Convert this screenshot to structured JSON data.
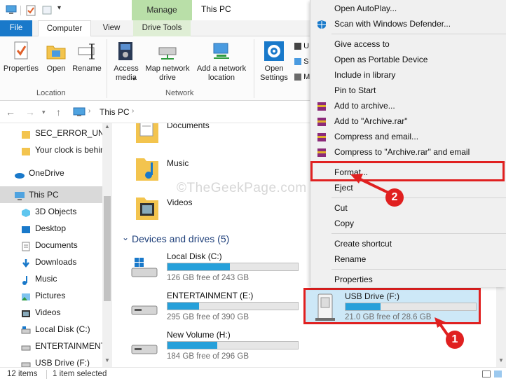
{
  "window": {
    "title": "This PC",
    "manage_tab": "Manage"
  },
  "ribbon_tabs": {
    "file": "File",
    "computer": "Computer",
    "view": "View",
    "drive_tools": "Drive Tools"
  },
  "ribbon": {
    "properties": "Properties",
    "open": "Open",
    "rename": "Rename",
    "access_media": "Access media",
    "map_network_drive": "Map network drive",
    "add_network_location_1": "Add a network",
    "add_network_location_2": "location",
    "open_settings_1": "Open",
    "open_settings_2": "Settings",
    "group_location": "Location",
    "group_network": "Network",
    "partial_u": "U",
    "partial_s": "S",
    "partial_m": "M"
  },
  "address": {
    "path": "This PC"
  },
  "nav": {
    "items": [
      {
        "label": "SEC_ERROR_UNKN",
        "icon": "folder-icon"
      },
      {
        "label": "Your clock is behin",
        "icon": "folder-icon"
      },
      {
        "label": "OneDrive",
        "icon": "cloud-icon"
      },
      {
        "label": "This PC",
        "icon": "computer-icon"
      },
      {
        "label": "3D Objects",
        "icon": "cube-icon"
      },
      {
        "label": "Desktop",
        "icon": "desktop-icon"
      },
      {
        "label": "Documents",
        "icon": "documents-icon"
      },
      {
        "label": "Downloads",
        "icon": "download-icon"
      },
      {
        "label": "Music",
        "icon": "music-icon"
      },
      {
        "label": "Pictures",
        "icon": "pictures-icon"
      },
      {
        "label": "Videos",
        "icon": "videos-icon"
      },
      {
        "label": "Local Disk (C:)",
        "icon": "disk-icon"
      },
      {
        "label": "ENTERTAINMENT (",
        "icon": "disk-icon"
      },
      {
        "label": "USB Drive (F:)",
        "icon": "usb-icon"
      }
    ]
  },
  "content": {
    "folders": [
      {
        "label": "Documents"
      },
      {
        "label": "Music"
      },
      {
        "label": "Videos"
      }
    ],
    "devices_header": "Devices and drives (5)",
    "drives": [
      {
        "name": "Local Disk (C:)",
        "free": "126 GB free of 243 GB",
        "used_fraction": 0.48
      },
      {
        "name": "ENTERTAINMENT (E:)",
        "free": "295 GB free of 390 GB",
        "used_fraction": 0.24
      },
      {
        "name": "New Volume (H:)",
        "free": "184 GB free of 296 GB",
        "used_fraction": 0.38
      }
    ],
    "usb": {
      "name": "USB Drive (F:)",
      "free": "21.0 GB free of 28.6 GB",
      "used_fraction": 0.27
    }
  },
  "status": {
    "items": "12 items",
    "selected": "1 item selected"
  },
  "context_menu": {
    "items": [
      "Open AutoPlay...",
      "Scan with Windows Defender...",
      "Give access to",
      "Open as Portable Device",
      "Include in library",
      "Pin to Start",
      "Add to archive...",
      "Add to \"Archive.rar\"",
      "Compress and email...",
      "Compress to \"Archive.rar\" and email",
      "Format...",
      "Eject",
      "Cut",
      "Copy",
      "Create shortcut",
      "Rename",
      "Properties"
    ]
  },
  "annotations": {
    "step1": "1",
    "step2": "2",
    "watermark": "©TheGeekPage.com",
    "highlight_color": "#e02020"
  },
  "colors": {
    "accent": "#1979ca",
    "bar_fill": "#26a0da",
    "manage_tab_bg": "#b9dfa8",
    "selection_bg": "#cde8f7"
  }
}
